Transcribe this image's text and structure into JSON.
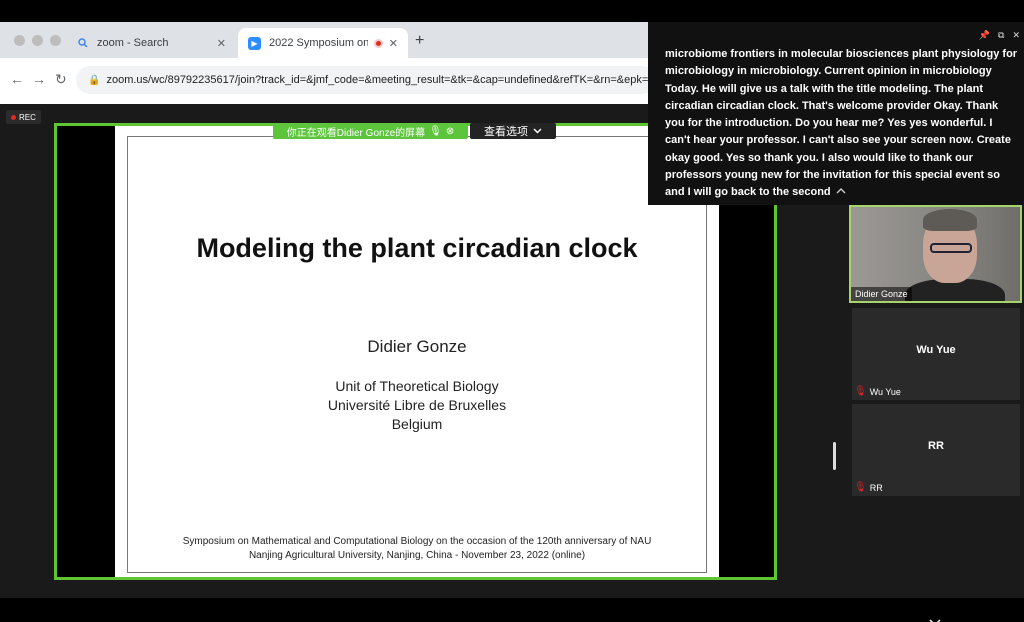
{
  "browser": {
    "tabs": [
      {
        "title": "zoom - Search",
        "active": false
      },
      {
        "title": "2022 Symposium on Mathe",
        "active": true
      }
    ],
    "url": "zoom.us/wc/89792235617/join?track_id=&jmf_code=&meeting_result=&tk=&cap=undefined&refTK=&rn=&epk=OMb"
  },
  "zoom": {
    "rec_label": "REC",
    "viewing_banner": "你正在观看Didier Gonze的屏幕",
    "view_options": "查看选项",
    "slide": {
      "title": "Modeling the plant circadian clock",
      "author": "Didier Gonze",
      "affiliation": [
        "Unit of Theoretical Biology",
        "Université Libre de Bruxelles",
        "Belgium"
      ],
      "footer": [
        "Symposium on Mathematical and Computational Biology on the occasion of the 120th anniversary of NAU",
        "Nanjing Agricultural University, Nanjing, China - November 23, 2022 (online)"
      ]
    },
    "captions": "microbiome frontiers in molecular biosciences plant physiology for microbiology in microbiology. Current opinion in microbiology Today. He will give us a talk with the title modeling. The plant circadian circadian clock. That's welcome provider Okay. Thank you for the introduction. Do you hear me? Yes yes wonderful. I can't hear your professor. I can't also see your screen now. Create okay good. Yes so thank you. I also would like to thank our professors young new for the invitation for this special event so and I will go back to the second",
    "participants": [
      {
        "name": "Didier Gonze",
        "video": true
      },
      {
        "name": "Wu Yue",
        "label": "Wu Yue",
        "muted": true
      },
      {
        "name": "RR",
        "label": "RR",
        "muted": true
      }
    ]
  }
}
